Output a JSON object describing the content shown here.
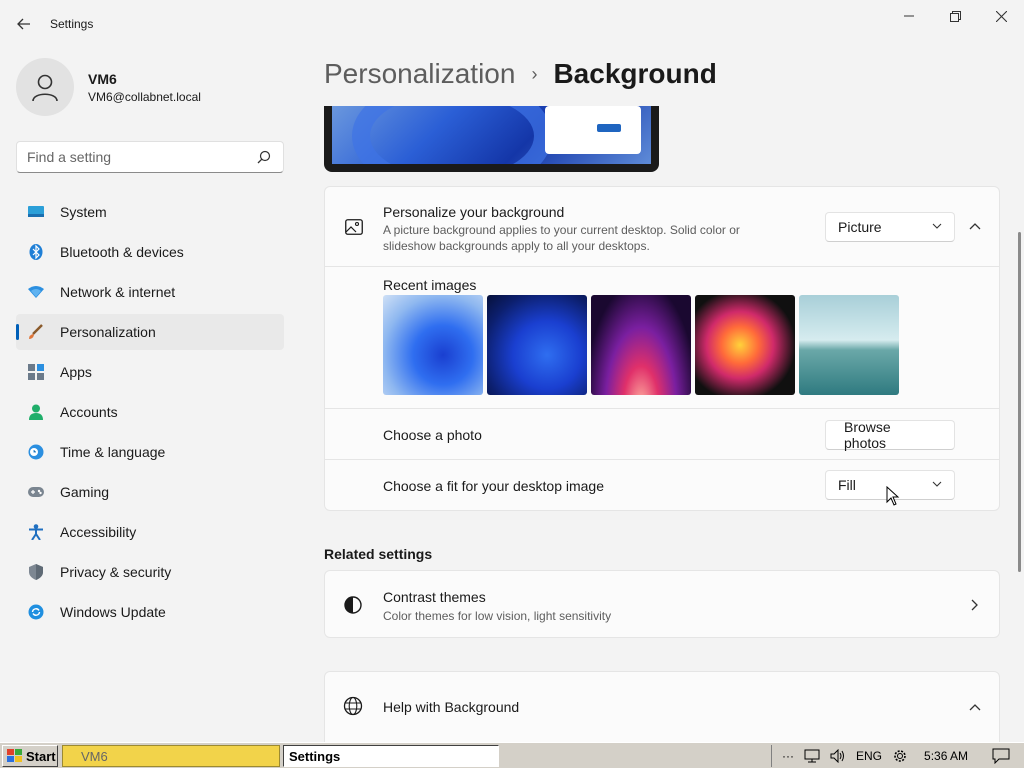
{
  "window": {
    "title": "Settings",
    "minimize": "—",
    "restore": "❐",
    "close": "✕"
  },
  "profile": {
    "name": "VM6",
    "email": "VM6@collabnet.local"
  },
  "search": {
    "placeholder": "Find a setting"
  },
  "sidebar": {
    "items": [
      {
        "label": "System",
        "icon": "system-icon"
      },
      {
        "label": "Bluetooth & devices",
        "icon": "bluetooth-icon"
      },
      {
        "label": "Network & internet",
        "icon": "network-icon"
      },
      {
        "label": "Personalization",
        "icon": "personalization-icon",
        "active": true
      },
      {
        "label": "Apps",
        "icon": "apps-icon"
      },
      {
        "label": "Accounts",
        "icon": "accounts-icon"
      },
      {
        "label": "Time & language",
        "icon": "time-language-icon"
      },
      {
        "label": "Gaming",
        "icon": "gaming-icon"
      },
      {
        "label": "Accessibility",
        "icon": "accessibility-icon"
      },
      {
        "label": "Privacy & security",
        "icon": "privacy-icon"
      },
      {
        "label": "Windows Update",
        "icon": "windows-update-icon"
      }
    ]
  },
  "breadcrumb": {
    "parent": "Personalization",
    "separator": "›",
    "current": "Background"
  },
  "background_card": {
    "title": "Personalize your background",
    "subtitle": "A picture background applies to your current desktop. Solid color or slideshow backgrounds apply to all your desktops.",
    "type_value": "Picture",
    "recent_label": "Recent images",
    "choose_photo_label": "Choose a photo",
    "browse_label": "Browse photos",
    "fit_label": "Choose a fit for your desktop image",
    "fit_value": "Fill"
  },
  "related": {
    "heading": "Related settings",
    "contrast_title": "Contrast themes",
    "contrast_sub": "Color themes for low vision, light sensitivity"
  },
  "help": {
    "title": "Help with Background"
  },
  "taskbar": {
    "start": "Start",
    "vm_task": "VM6",
    "settings_task": "Settings",
    "overflow": "···",
    "language": "ENG",
    "time": "5:36 AM"
  },
  "colors": {
    "accent": "#005fb8",
    "taskbar_vm": "#f2d34a"
  }
}
